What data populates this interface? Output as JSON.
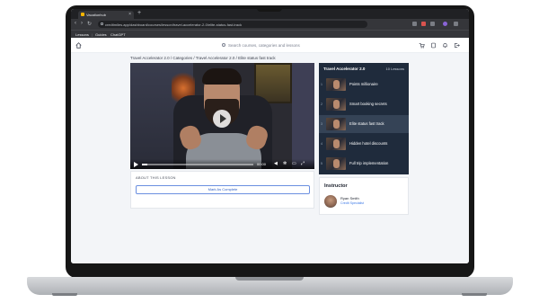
{
  "browser": {
    "tab_title": "Vacationhub",
    "tab_close": "×",
    "new_tab": "+",
    "nav_back": "‹",
    "nav_forward": "›",
    "nav_reload": "↻",
    "url": "creditmiles.app/dashboard/courses/lesson/travel-accelerator-2-0/elite-status-fast-track",
    "bookmarks": [
      "Lessons",
      "|",
      "Guides",
      "ChatGPT"
    ]
  },
  "site": {
    "search_placeholder": "Search courses, categories and lessons"
  },
  "breadcrumb": "Travel Accelerator 2.0 / Categories / Travel Accelerator 2.0 / Elite status fast track",
  "player": {
    "time": "00:00",
    "progress": 0.05
  },
  "about": {
    "label": "ABOUT THIS LESSON",
    "complete_button": "Mark As Complete"
  },
  "course": {
    "title": "Travel Accelerator 2.0",
    "count": "10 Lessons",
    "lessons": [
      {
        "num": "1",
        "title": "Points millionaire"
      },
      {
        "num": "2",
        "title": "Smart booking secrets"
      },
      {
        "num": "3",
        "title": "Elite status fast track"
      },
      {
        "num": "4",
        "title": "Hidden hotel discounts"
      },
      {
        "num": "5",
        "title": "Full trip implementation"
      }
    ]
  },
  "instructor": {
    "heading": "Instructor",
    "name": "Ryan Smith",
    "role": "Credit Specialist"
  }
}
